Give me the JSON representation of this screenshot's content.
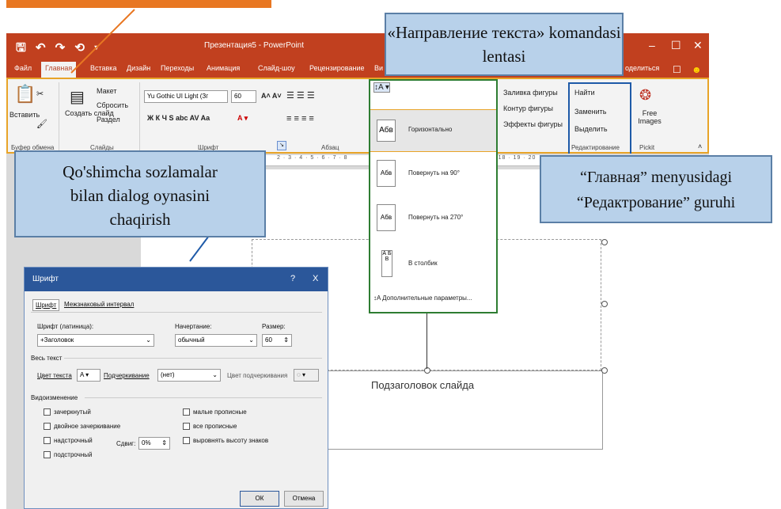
{
  "window": {
    "title": "Презентация5 - PowerPoint",
    "qat": "🖫 ↶ ↷ ⟲ ▾",
    "minimize": "–",
    "maximize": "☐",
    "close": "✕"
  },
  "tabs": [
    "Файл",
    "Главная",
    "Вставка",
    "Дизайн",
    "Переходы",
    "Анимация",
    "Слайд-шоу",
    "Рецензирование",
    "Ви"
  ],
  "share": "оделиться",
  "ribbon": {
    "paste": "Вставить",
    "layout": "Макет",
    "reset": "Сбросить",
    "create_slide": "Создать слайд",
    "section": "Раздел",
    "font_name": "Yu Gothic UI Light (Зг",
    "font_size": "60",
    "bold_row": "Ж К Ч S abc AV Aa",
    "groups": {
      "clipboard": "Буфер обмена",
      "slides": "Слайды",
      "font": "Шрифт",
      "paragraph": "Абзац",
      "editing": "Редактирование",
      "pickit": "Pickit"
    },
    "fill": "Заливка фигуры",
    "outline": "Контур фигуры",
    "effects": "Эффекты фигуры",
    "find": "Найти",
    "replace": "Заменить",
    "select": "Выделить",
    "free_images": "Free Images"
  },
  "ruler": "2 · 3 · 4 · 5 · 6 · 7 · 8",
  "ruler_right": "18 · 19 · 20",
  "direction_menu": {
    "horizontal": "Горизонтально",
    "rotate90": "Повернуть на 90°",
    "rotate270": "Повернуть на 270°",
    "stacked": "В столбик",
    "more": "Дополнительные параметры...",
    "icon_h": "Абв",
    "icon_90": "Абв",
    "icon_270": "Абв",
    "icon_stack": "А Б В"
  },
  "slide": {
    "subtitle": "Подзаголовок слайда"
  },
  "callouts": {
    "direction": "«Направление текста» komandasi lentasi",
    "dialog": "Qo'shimcha sozlamalar bilan dialog oynasini chaqirish",
    "editing": "“Главная”  menyusidagi “Редактрование” guruhi"
  },
  "dialog": {
    "title": "Шрифт",
    "help": "?",
    "close": "X",
    "tab_font": "Шрифт",
    "tab_spacing": "Межзнаковый интервал",
    "font_latin_label": "Шрифт (латиница):",
    "font_latin_value": "+Заголовок",
    "style_label": "Начертание:",
    "style_value": "обычный",
    "size_label": "Размер:",
    "size_value": "60",
    "all_text": "Весь текст",
    "text_color": "Цвет текста",
    "underline": "Подчеркивание",
    "underline_value": "(нет)",
    "underline_color": "Цвет подчеркивания",
    "effects": "Видоизменение",
    "strike": "зачеркнутый",
    "double_strike": "двойное зачеркивание",
    "superscript": "надстрочный",
    "subscript": "подстрочный",
    "offset_label": "Сдвиг:",
    "offset_value": "0%",
    "small_caps": "малые прописные",
    "all_caps": "все прописные",
    "equalize": "выровнять высоту знаков",
    "ok": "ОК",
    "cancel": "Отмена"
  },
  "colors": {
    "accent": "#c1401f",
    "dialog_title": "#2b579a",
    "callout": "#b8d1ea"
  }
}
